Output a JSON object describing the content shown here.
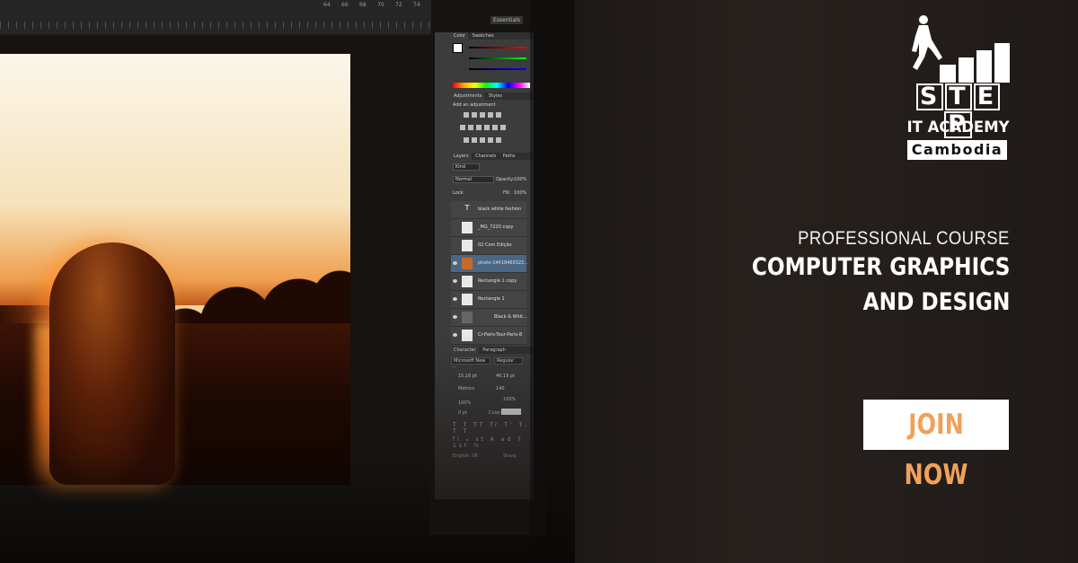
{
  "brand": {
    "logo_step": [
      "S",
      "T",
      "E",
      "P"
    ],
    "logo_line2": "IT ACADEMY",
    "logo_line3": "Cambodia"
  },
  "course": {
    "pretitle": "PROFESSIONAL COURSE",
    "title_line1": "COMPUTER GRAPHICS",
    "title_line2": "AND DESIGN"
  },
  "cta": {
    "label": "JOIN NOW"
  },
  "photoshop": {
    "tabs_color": [
      "Color",
      "Swatches"
    ],
    "tabs_adjust": [
      "Adjustments",
      "Styles"
    ],
    "adjust_heading": "Add an adjustment",
    "tabs_layers": [
      "Layers",
      "Channels",
      "Paths"
    ],
    "kind": "Kind",
    "blend": "Normal",
    "opacity_label": "Opacity:",
    "opacity": "100%",
    "lock_label": "Lock:",
    "fill_label": "Fill:",
    "fill": "100%",
    "layers": [
      {
        "name": "black white fashion"
      },
      {
        "name": "_MG_7220 copy"
      },
      {
        "name": "02 Com Edição"
      },
      {
        "name": "photo-14418460322..."
      },
      {
        "name": "Rectangle 1 copy"
      },
      {
        "name": "Rectangle 1"
      },
      {
        "name": "Black & Whit..."
      },
      {
        "name": "Cr-Paris-Tour-Paris-8"
      }
    ],
    "tabs_char": [
      "Character",
      "Paragraph"
    ],
    "font": "Microsoft New ...",
    "style": "Regular",
    "size": "15,16 pt",
    "leading": "46,19 pt",
    "kerning": "Metrics",
    "tracking": "140",
    "vscale": "100%",
    "hscale": "100%",
    "baseline": "0 pt",
    "color_label": "Color:",
    "language": "English: UK",
    "aa": "Sharp",
    "ruler_numbers": [
      "64",
      "66",
      "68",
      "70",
      "72",
      "74"
    ],
    "essentials": "Essentials",
    "glyphs_row1": "T T TT Tr T' T, T T",
    "glyphs_row2": "fi ℴ st A ad T 1st ½"
  },
  "colors": {
    "background": "#231e1b",
    "cta_text": "#f0a15b",
    "cta_bg": "#ffffff",
    "text": "#ffffff"
  }
}
